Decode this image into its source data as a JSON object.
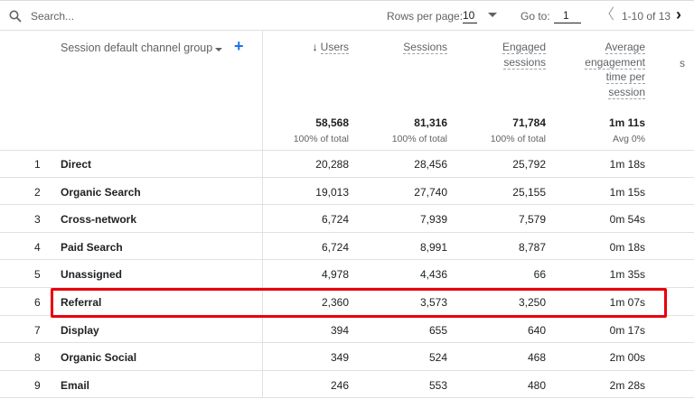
{
  "toolbar": {
    "search_placeholder": "Search...",
    "rows_per_page_label": "Rows per page:",
    "rows_per_page_value": "10",
    "go_to_label": "Go to:",
    "go_to_value": "1",
    "range_text": "1-10 of 13"
  },
  "header": {
    "dimension_label": "Session default channel group",
    "columns": [
      {
        "label_lines": [
          "Users"
        ],
        "sorted": true,
        "total": "58,568",
        "sub": "100% of total"
      },
      {
        "label_lines": [
          "Sessions"
        ],
        "sorted": false,
        "total": "81,316",
        "sub": "100% of total"
      },
      {
        "label_lines": [
          "Engaged",
          "sessions"
        ],
        "sorted": false,
        "total": "71,784",
        "sub": "100% of total"
      },
      {
        "label_lines": [
          "Average",
          "engagement",
          "time per",
          "session"
        ],
        "sorted": false,
        "total": "1m 11s",
        "sub": "Avg 0%"
      }
    ],
    "sort_arrow": "↓",
    "clipped_column_fragment": "s"
  },
  "rows": [
    {
      "index": "1",
      "channel": "Direct",
      "users": "20,288",
      "sessions": "28,456",
      "engaged": "25,792",
      "avg_time": "1m 18s"
    },
    {
      "index": "2",
      "channel": "Organic Search",
      "users": "19,013",
      "sessions": "27,740",
      "engaged": "25,155",
      "avg_time": "1m 15s"
    },
    {
      "index": "3",
      "channel": "Cross-network",
      "users": "6,724",
      "sessions": "7,939",
      "engaged": "7,579",
      "avg_time": "0m 54s"
    },
    {
      "index": "4",
      "channel": "Paid Search",
      "users": "6,724",
      "sessions": "8,991",
      "engaged": "8,787",
      "avg_time": "0m 18s"
    },
    {
      "index": "5",
      "channel": "Unassigned",
      "users": "4,978",
      "sessions": "4,436",
      "engaged": "66",
      "avg_time": "1m 35s"
    },
    {
      "index": "6",
      "channel": "Referral",
      "users": "2,360",
      "sessions": "3,573",
      "engaged": "3,250",
      "avg_time": "1m 07s"
    },
    {
      "index": "7",
      "channel": "Display",
      "users": "394",
      "sessions": "655",
      "engaged": "640",
      "avg_time": "0m 17s"
    },
    {
      "index": "8",
      "channel": "Organic Social",
      "users": "349",
      "sessions": "524",
      "engaged": "468",
      "avg_time": "2m 00s"
    },
    {
      "index": "9",
      "channel": "Email",
      "users": "246",
      "sessions": "553",
      "engaged": "480",
      "avg_time": "2m 28s"
    }
  ],
  "highlight_row_index": "6",
  "colors": {
    "accent": "#1a73e8",
    "highlight": "#e8000b",
    "grid": "#e0e0e0"
  }
}
